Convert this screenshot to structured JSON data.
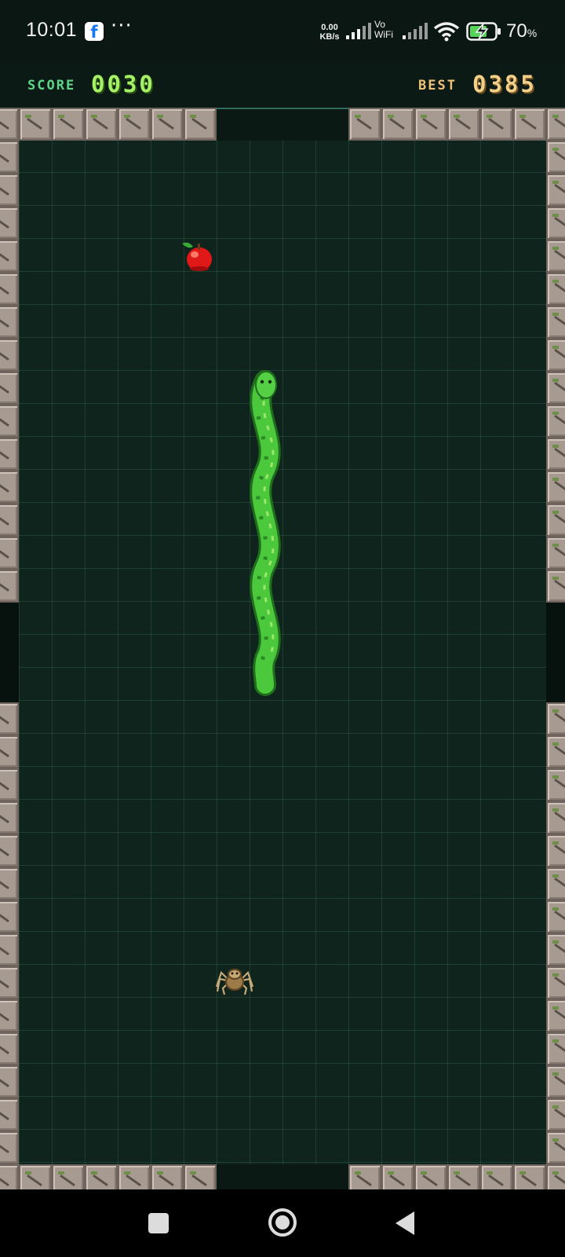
{
  "status_bar": {
    "time": "10:01",
    "notification_app_icon": "facebook-icon",
    "more_indicator": "···",
    "net_speed_value": "0.00",
    "net_speed_unit": "KB/s",
    "vowifi_line1": "Vo",
    "vowifi_line2": "WiFi",
    "battery_percent": "70",
    "battery_percent_sign": "%",
    "battery_level": 0.7,
    "battery_charging": true,
    "icons": [
      "signal-icon",
      "signal-icon",
      "wifi-icon",
      "battery-charging-icon"
    ]
  },
  "hud": {
    "score_label": "SCORE",
    "score_value": "0030",
    "best_label": "BEST",
    "best_value": "0385",
    "colors": {
      "score": "#a6f068",
      "best": "#f3d08a"
    }
  },
  "board": {
    "items": [
      "apple-icon",
      "spider-icon",
      "snake"
    ],
    "snake_direction": "up",
    "colors": {
      "background": "#0e241c",
      "snake": "#4cc83c",
      "wall": "#a79a90"
    }
  },
  "nav_bar": {
    "buttons": [
      "recent-apps-button",
      "home-button",
      "back-button"
    ]
  }
}
